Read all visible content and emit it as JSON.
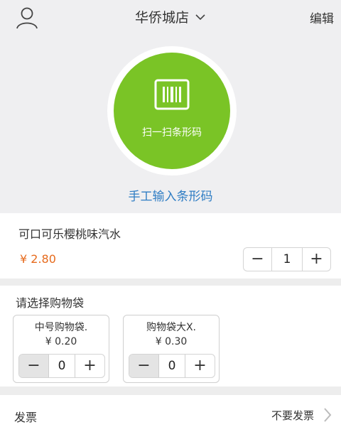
{
  "header": {
    "store_name": "华侨城店",
    "edit_label": "编辑",
    "user_icon": "user-icon",
    "store_dropdown_icon": "chevron-down-icon"
  },
  "scan": {
    "label": "扫一扫条形码",
    "icon": "barcode-icon",
    "manual_entry": "手工输入条形码",
    "accent_color": "#7ac426"
  },
  "product": {
    "name": "可口可乐樱桃味汽水",
    "price": "¥ 2.80",
    "quantity": "1",
    "price_color": "#e66a1c"
  },
  "bags": {
    "title": "请选择购物袋",
    "items": [
      {
        "name": "中号购物袋.",
        "price": "¥ 0.20",
        "quantity": "0"
      },
      {
        "name": "购物袋大X.",
        "price": "¥ 0.30",
        "quantity": "0"
      }
    ]
  },
  "invoice": {
    "label": "发票",
    "value": "不要发票",
    "icon": "chevron-right-icon"
  },
  "stepper": {
    "minus": "−",
    "plus": "+"
  }
}
